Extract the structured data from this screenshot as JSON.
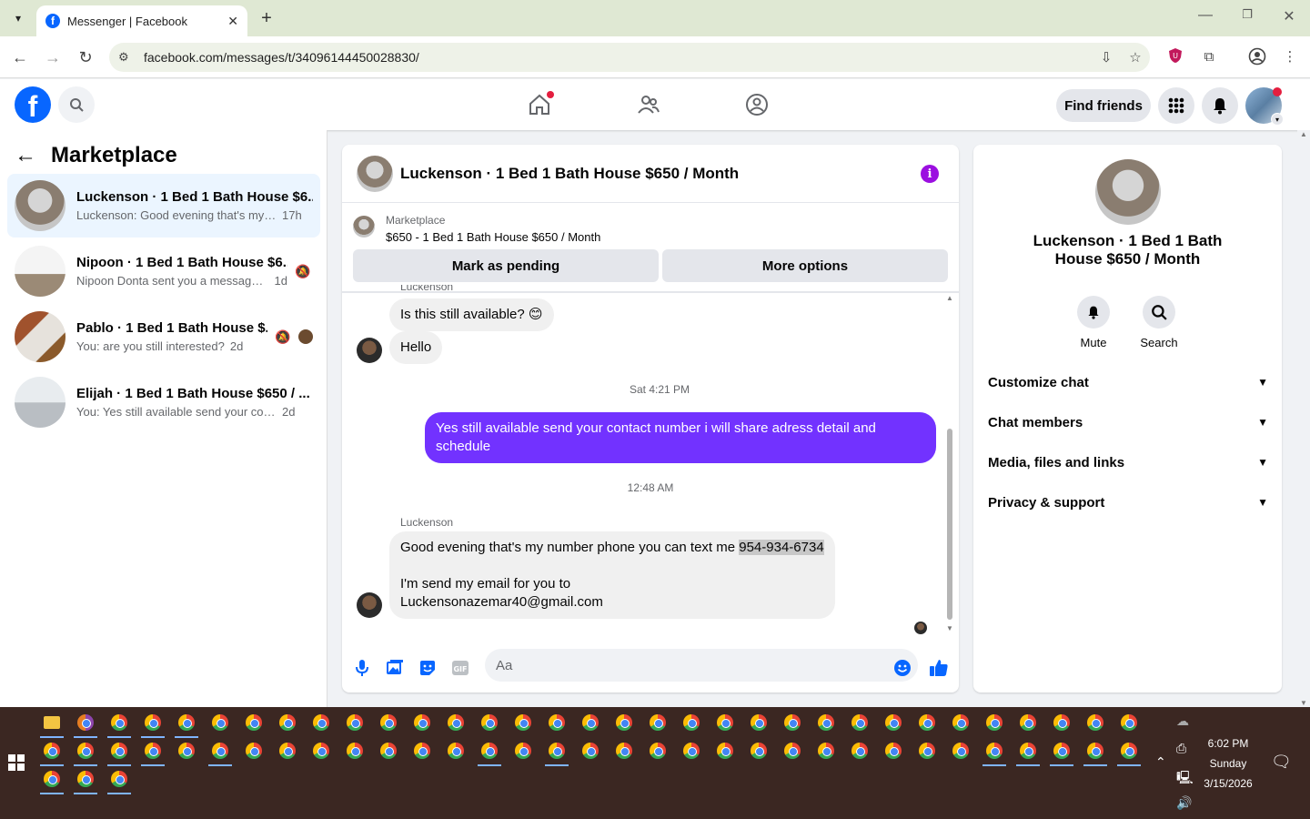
{
  "browser": {
    "tab_title": "Messenger | Facebook",
    "url": "facebook.com/messages/t/34096144450028830/"
  },
  "fb_header": {
    "find_friends": "Find friends"
  },
  "left_panel": {
    "title": "Marketplace",
    "conversations": [
      {
        "name": "Luckenson · 1 Bed 1 Bath House $6...",
        "preview": "Luckenson: Good evening that's my ...",
        "time": "17h"
      },
      {
        "name": "Nipoon · 1 Bed 1 Bath House $6...",
        "preview": "Nipoon Donta sent you a message ...",
        "time": "1d"
      },
      {
        "name": "Pablo · 1 Bed 1 Bath House $...",
        "preview": "You: are you still interested?",
        "time": "2d"
      },
      {
        "name": "Elijah · 1 Bed 1 Bath House $650 / ...",
        "preview": "You: Yes still available send your conta...",
        "time": "2d"
      }
    ]
  },
  "chat": {
    "title": "Luckenson · 1 Bed 1 Bath House $650 / Month",
    "marketplace_label": "Marketplace",
    "listing": "$650 - 1 Bed 1 Bath House $650 / Month",
    "mark_pending": "Mark as pending",
    "more_options": "More options",
    "cut_sender": "Luckenson",
    "msg1": "Is this still available? 😊",
    "msg2": "Hello",
    "time1": "Sat 4:21 PM",
    "out_msg": "Yes still available send your contact number i will share adress detail and schedule",
    "time2": "12:48 AM",
    "sender": "Luckenson",
    "msg3_a": "Good evening that's my number phone you can text me ",
    "msg3_phone": "954-934-6734",
    "msg3_b": "I'm send my email for you to",
    "msg3_c": "Luckensonazemar40@gmail.com",
    "composer_placeholder": "Aa"
  },
  "right_panel": {
    "name": "Luckenson · 1 Bed 1 Bath House $650 / Month",
    "mute": "Mute",
    "search": "Search",
    "rows": [
      "Customize chat",
      "Chat members",
      "Media, files and links",
      "Privacy & support"
    ]
  },
  "taskbar": {
    "time": "6:02 PM",
    "day": "Sunday",
    "date": "3/15/2026"
  },
  "colors": {
    "accent": "#0866ff",
    "outgoing_bubble": "#7232ff",
    "info_icon": "#9b0fe0",
    "taskbar": "#3b2722"
  }
}
